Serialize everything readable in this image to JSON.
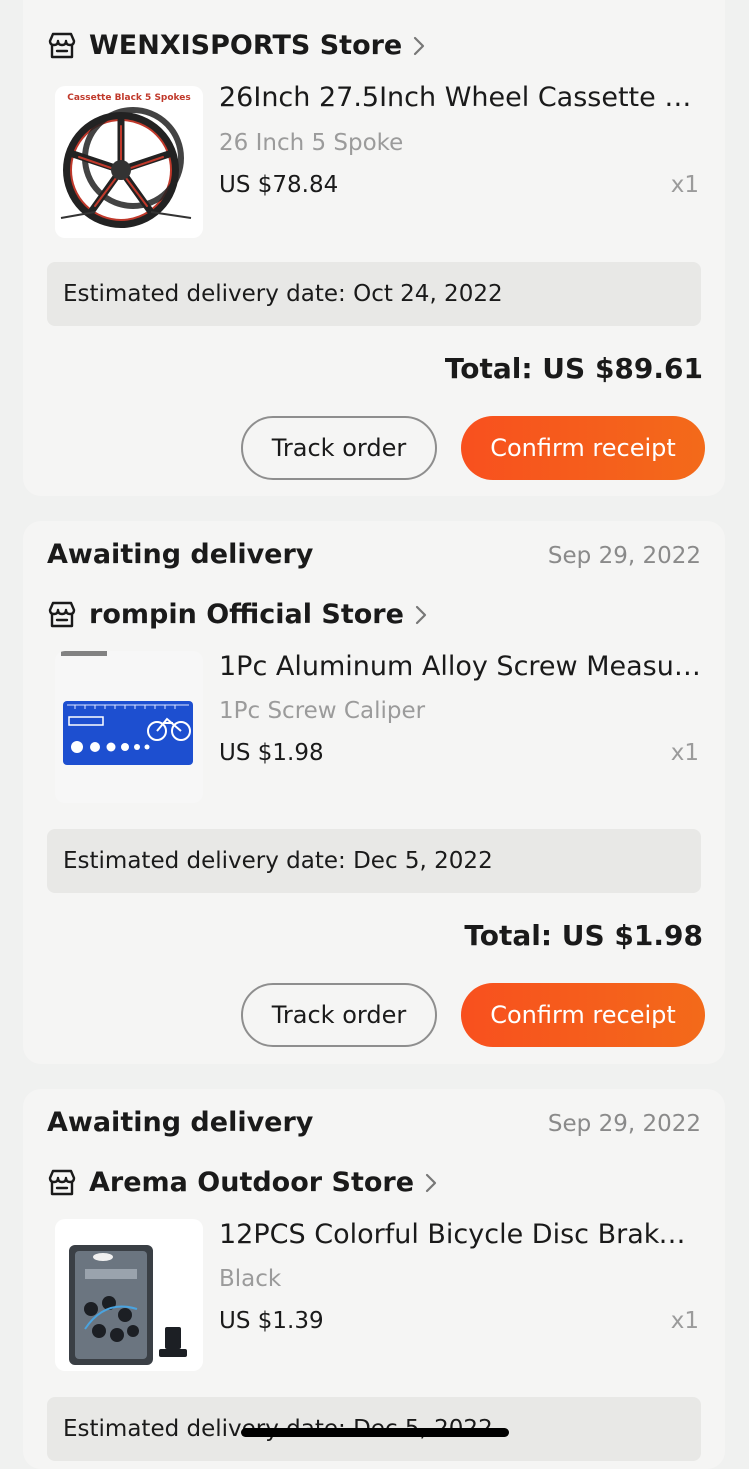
{
  "orders": [
    {
      "store": "WENXISPORTS Store",
      "product_title": "26Inch 27.5Inch Wheel Cassette M...",
      "variant": "26 Inch 5 Spoke",
      "price": "US $78.84",
      "qty": "x1",
      "thumb_caption": "Cassette Black 5 Spokes",
      "delivery": "Estimated delivery date: Oct 24, 2022",
      "total": "Total: US $89.61",
      "track_label": "Track order",
      "confirm_label": "Confirm receipt"
    },
    {
      "status": "Awaiting delivery",
      "date": "Sep 29, 2022",
      "store": "rompin Official Store",
      "product_title": "1Pc Aluminum Alloy Screw Measuri...",
      "variant": "1Pc Screw Caliper",
      "price": "US $1.98",
      "qty": "x1",
      "delivery": "Estimated delivery date: Dec 5, 2022",
      "total": "Total: US $1.98",
      "track_label": "Track order",
      "confirm_label": "Confirm receipt"
    },
    {
      "status": "Awaiting delivery",
      "date": "Sep 29, 2022",
      "store": "Arema Outdoor Store",
      "product_title": "12PCS Colorful Bicycle Disc Brake R...",
      "variant": "Black",
      "price": "US $1.39",
      "qty": "x1",
      "delivery": "Estimated delivery date: Dec 5, 2022"
    }
  ],
  "colors": {
    "accent": "#f8501e",
    "background": "#f0f1f0",
    "card": "#f5f5f4",
    "muted_text": "#9b9b9b"
  }
}
